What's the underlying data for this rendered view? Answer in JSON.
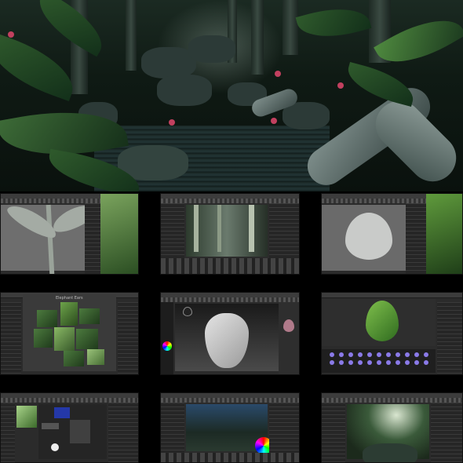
{
  "hero": {
    "description_icon": "jungle-render"
  },
  "shots": [
    {
      "id": "leaf-modeling-viewport",
      "icon": "banana-leaf"
    },
    {
      "id": "bamboo-scene-render",
      "icon": "bamboo-forest"
    },
    {
      "id": "leaf-uv-texture",
      "icon": "fern-leaf"
    },
    {
      "id": "reference-board",
      "icon": "photo-collage",
      "board_title": "Elephant Ears"
    },
    {
      "id": "leaf-sculpt",
      "icon": "heart-leaf"
    },
    {
      "id": "leaf-material-editor",
      "icon": "green-leaf"
    },
    {
      "id": "node-shader-editor",
      "icon": "node-graph"
    },
    {
      "id": "lighting-pass",
      "icon": "color-wheel"
    },
    {
      "id": "final-scene-lighting",
      "icon": "sunbeam"
    }
  ],
  "colors": {
    "background": "#000000",
    "panel": "#2b2b2b",
    "accent_green": "#3f7a2e",
    "flower": "#c2405f"
  }
}
